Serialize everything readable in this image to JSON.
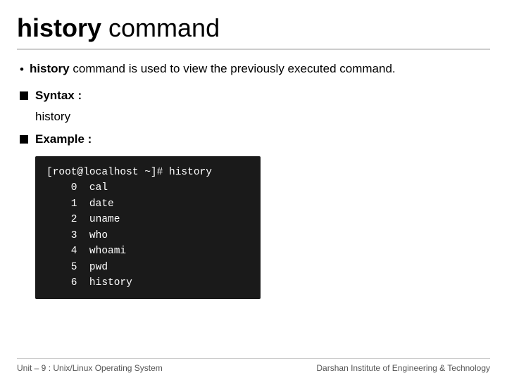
{
  "title": {
    "bold_part": "history",
    "regular_part": " command"
  },
  "description": {
    "text_parts": [
      "history",
      " command is used to view the previously executed command."
    ]
  },
  "syntax": {
    "label": "Syntax :",
    "code": "history"
  },
  "example": {
    "label": "Example :",
    "terminal_lines": [
      "[root@localhost ~]# history",
      "    0  cal",
      "    1  date",
      "    2  uname",
      "    3  who",
      "    4  whoami",
      "    5  pwd",
      "    6  history"
    ]
  },
  "footer": {
    "left": "Unit – 9 : Unix/Linux Operating System",
    "right": "Darshan Institute of Engineering & Technology"
  }
}
